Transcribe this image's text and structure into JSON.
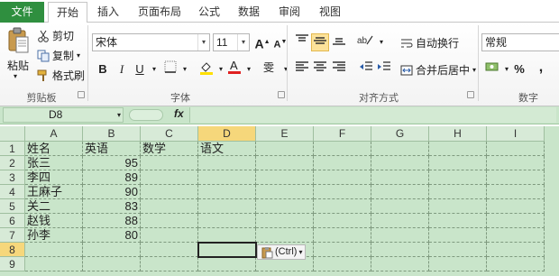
{
  "tabs": {
    "file": "文件",
    "items": [
      "开始",
      "插入",
      "页面布局",
      "公式",
      "数据",
      "审阅",
      "视图"
    ]
  },
  "ribbon": {
    "clipboard": {
      "paste": "粘贴",
      "cut": "剪切",
      "copy": "复制",
      "format_painter": "格式刷",
      "group_label": "剪贴板"
    },
    "font": {
      "font_name": "宋体",
      "font_size": "11",
      "grow": "A",
      "shrink": "A",
      "bold": "B",
      "italic": "I",
      "underline": "U",
      "phonetic": "wén",
      "group_label": "字体"
    },
    "alignment": {
      "wrap_text": "自动换行",
      "merge_center": "合并后居中",
      "group_label": "对齐方式"
    },
    "number": {
      "format": "常规",
      "percent": "%",
      "comma": ",",
      "group_label": "数字"
    }
  },
  "formula_bar": {
    "name_box": "D8",
    "fx": "fx",
    "formula": ""
  },
  "sheet": {
    "columns": [
      "A",
      "B",
      "C",
      "D",
      "E",
      "F",
      "G",
      "H",
      "I"
    ],
    "rows": [
      "1",
      "2",
      "3",
      "4",
      "5",
      "6",
      "7",
      "8",
      "9"
    ],
    "header_row": [
      "姓名",
      "英语",
      "数学",
      "语文"
    ],
    "data": [
      {
        "name": "张三",
        "english": "95"
      },
      {
        "name": "李四",
        "english": "89"
      },
      {
        "name": "王麻子",
        "english": "90"
      },
      {
        "name": "关二",
        "english": "83"
      },
      {
        "name": "赵钱",
        "english": "88"
      },
      {
        "name": "孙李",
        "english": "80"
      }
    ],
    "selected_cell": "D8"
  },
  "paste_options": {
    "label": "(Ctrl)"
  },
  "colors": {
    "file_tab": "#2f8f3f",
    "sheet_background": "#c9e5ca",
    "selected_header": "#f6d77b"
  }
}
